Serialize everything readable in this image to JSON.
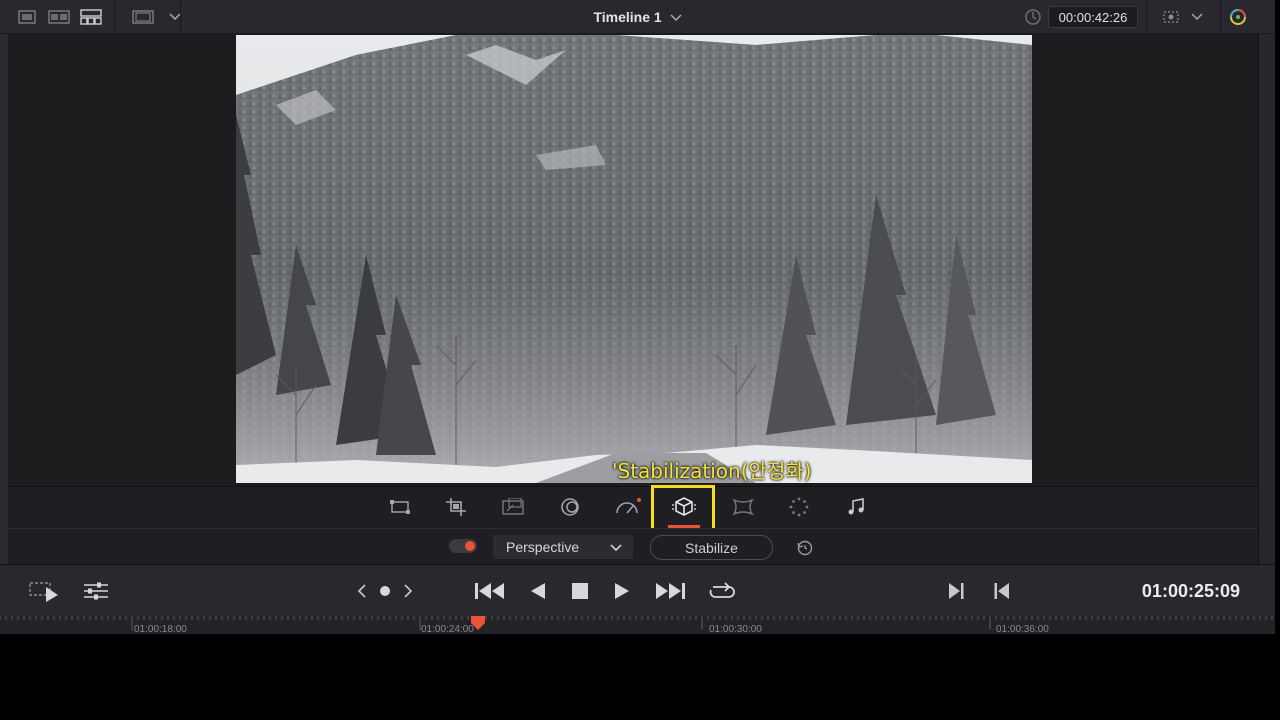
{
  "header": {
    "timeline_title": "Timeline 1",
    "source_timecode": "00:00:42:26",
    "left_icons": [
      "single-viewer-icon",
      "dual-viewer-icon",
      "cinema-viewer-icon",
      "viewer-size-icon"
    ],
    "right_icons": [
      "clip-sync-icon",
      "viewer-options-icon",
      "color-picker-icon"
    ]
  },
  "viewer": {
    "annotation": "'Stabilization(안정화)"
  },
  "inspector_tools": [
    {
      "name": "transform-icon"
    },
    {
      "name": "crop-icon"
    },
    {
      "name": "dynamic-zoom-icon"
    },
    {
      "name": "composite-icon"
    },
    {
      "name": "retime-speed-icon"
    },
    {
      "name": "stabilization-icon",
      "active": true
    },
    {
      "name": "lens-correction-icon"
    },
    {
      "name": "fx-overlay-icon"
    },
    {
      "name": "audio-icon"
    }
  ],
  "stabilization": {
    "mode": "Perspective",
    "stabilize_label": "Stabilize",
    "enabled": true
  },
  "transport": {
    "record_timecode": "01:00:25:09"
  },
  "ruler": {
    "labels": [
      "01:00:18:00",
      "01:00:24:00",
      "01:00:30:00",
      "01:00:36:00"
    ]
  },
  "colors": {
    "accent": "#e8533a",
    "highlight": "#f7dd1b",
    "panel": "#1f1f23"
  }
}
